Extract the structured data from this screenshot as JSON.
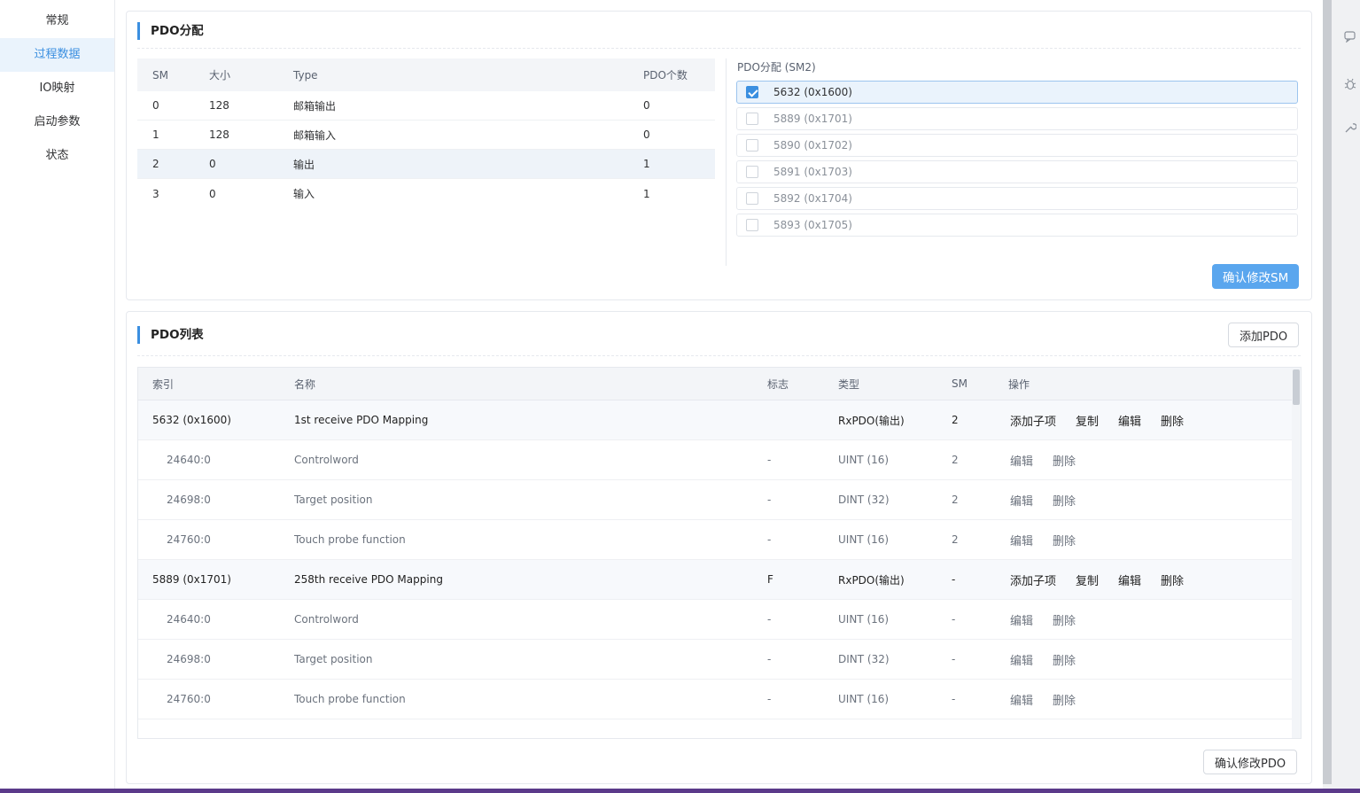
{
  "sidebar": {
    "items": [
      {
        "label": "常规",
        "active": false
      },
      {
        "label": "过程数据",
        "active": true
      },
      {
        "label": "IO映射",
        "active": false
      },
      {
        "label": "启动参数",
        "active": false
      },
      {
        "label": "状态",
        "active": false
      }
    ]
  },
  "pdo_assign": {
    "title": "PDO分配",
    "sm_headers": [
      "SM",
      "大小",
      "Type",
      "PDO个数"
    ],
    "sm_rows": [
      {
        "sm": "0",
        "size": "128",
        "type": "邮箱输出",
        "count": "0"
      },
      {
        "sm": "1",
        "size": "128",
        "type": "邮箱输入",
        "count": "0"
      },
      {
        "sm": "2",
        "size": "0",
        "type": "输出",
        "count": "1"
      },
      {
        "sm": "3",
        "size": "0",
        "type": "输入",
        "count": "1"
      }
    ],
    "assign_label": "PDO分配 (SM2)",
    "assign_items": [
      {
        "label": "5632 (0x1600)",
        "checked": true
      },
      {
        "label": "5889 (0x1701)",
        "checked": false
      },
      {
        "label": "5890 (0x1702)",
        "checked": false
      },
      {
        "label": "5891 (0x1703)",
        "checked": false
      },
      {
        "label": "5892 (0x1704)",
        "checked": false
      },
      {
        "label": "5893 (0x1705)",
        "checked": false
      }
    ],
    "confirm_label": "确认修改SM"
  },
  "pdo_list": {
    "title": "PDO列表",
    "add_label": "添加PDO",
    "headers": [
      "索引",
      "名称",
      "标志",
      "类型",
      "SM",
      "操作"
    ],
    "rows": [
      {
        "kind": "parent",
        "index": "5632 (0x1600)",
        "name": "1st receive PDO Mapping",
        "flag": "",
        "type": "RxPDO(输出)",
        "sm": "2",
        "ops": [
          "添加子项",
          "复制",
          "编辑",
          "删除"
        ]
      },
      {
        "kind": "child",
        "index": "24640:0",
        "name": "Controlword",
        "flag": "-",
        "type": "UINT (16)",
        "sm": "2",
        "ops": [
          "编辑",
          "删除"
        ]
      },
      {
        "kind": "child",
        "index": "24698:0",
        "name": "Target position",
        "flag": "-",
        "type": "DINT (32)",
        "sm": "2",
        "ops": [
          "编辑",
          "删除"
        ]
      },
      {
        "kind": "child",
        "index": "24760:0",
        "name": "Touch probe function",
        "flag": "-",
        "type": "UINT (16)",
        "sm": "2",
        "ops": [
          "编辑",
          "删除"
        ]
      },
      {
        "kind": "parent",
        "index": "5889 (0x1701)",
        "name": "258th receive PDO Mapping",
        "flag": "F",
        "type": "RxPDO(输出)",
        "sm": "-",
        "ops": [
          "添加子项",
          "复制",
          "编辑",
          "删除"
        ]
      },
      {
        "kind": "child",
        "index": "24640:0",
        "name": "Controlword",
        "flag": "-",
        "type": "UINT (16)",
        "sm": "-",
        "ops": [
          "编辑",
          "删除"
        ]
      },
      {
        "kind": "child",
        "index": "24698:0",
        "name": "Target position",
        "flag": "-",
        "type": "DINT (32)",
        "sm": "-",
        "ops": [
          "编辑",
          "删除"
        ]
      },
      {
        "kind": "child",
        "index": "24760:0",
        "name": "Touch probe function",
        "flag": "-",
        "type": "UINT (16)",
        "sm": "-",
        "ops": [
          "编辑",
          "删除"
        ]
      }
    ],
    "confirm_label": "确认修改PDO"
  },
  "right_panel": {
    "icons": [
      "chat-icon",
      "bug-icon",
      "tool-icon"
    ]
  },
  "colors": {
    "accent": "#3b8fe0",
    "primary_button": "#5aa6ee"
  }
}
